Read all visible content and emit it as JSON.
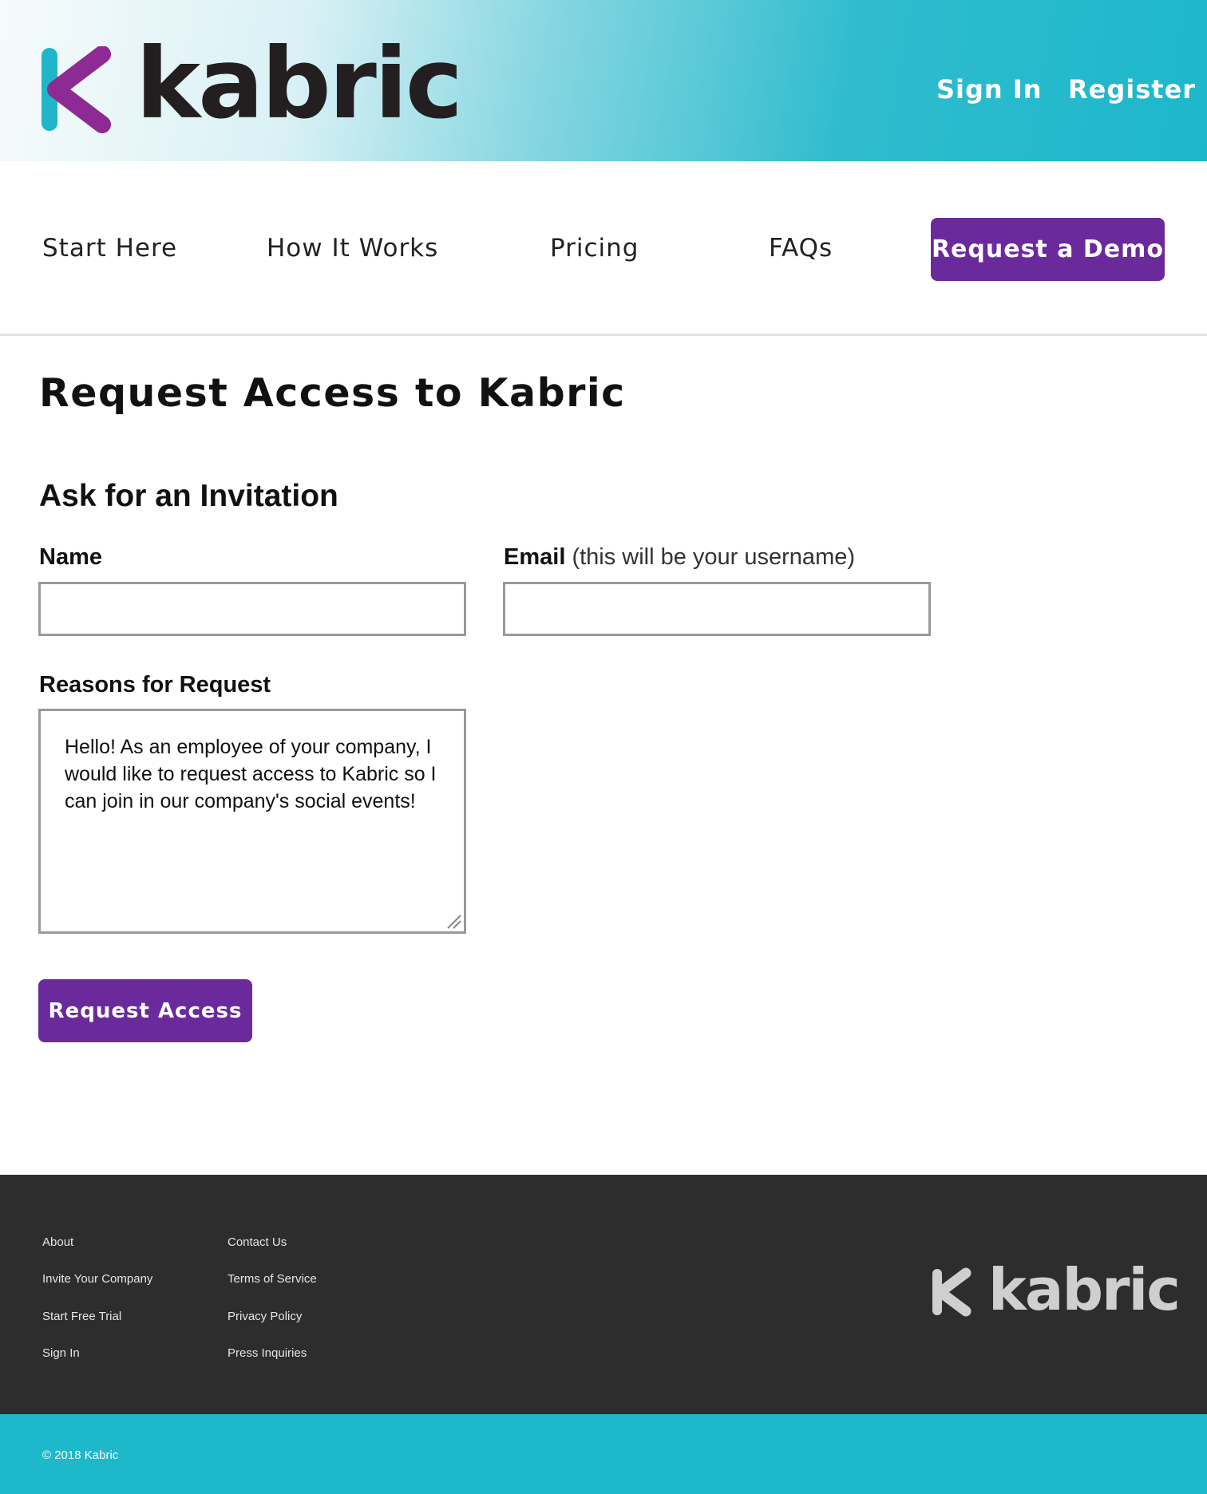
{
  "header": {
    "logo_text": "kabric",
    "sign_in": "Sign In",
    "register": "Register"
  },
  "nav": {
    "items": [
      {
        "label": "Start Here"
      },
      {
        "label": "How It Works"
      },
      {
        "label": "Pricing"
      },
      {
        "label": "FAQs"
      }
    ],
    "demo_button": "Request a Demo"
  },
  "main": {
    "title": "Request Access to Kabric",
    "section_title": "Ask for an Invitation",
    "name_label": "Name",
    "name_value": "",
    "email_label": "Email",
    "email_hint": "(this will be your username)",
    "email_value": "",
    "reasons_label": "Reasons for Request",
    "reasons_value": "Hello! As an employee of your company, I would like to request access to Kabric so I can join in our company's social events!",
    "submit_button": "Request Access"
  },
  "footer": {
    "col1": [
      "About",
      "Invite Your Company",
      "Start Free Trial",
      "Sign In"
    ],
    "col2": [
      "Contact Us",
      "Terms of Service",
      "Privacy Policy",
      "Press Inquiries"
    ],
    "logo_text": "kabric",
    "copyright": "© 2018 Kabric"
  },
  "colors": {
    "brand_teal": "#1db7cb",
    "brand_purple": "#6b2a9c",
    "footer_dark": "#2d2d2e"
  },
  "icons": [
    "kabric-logo-mark-icon",
    "resize-grip-icon"
  ]
}
